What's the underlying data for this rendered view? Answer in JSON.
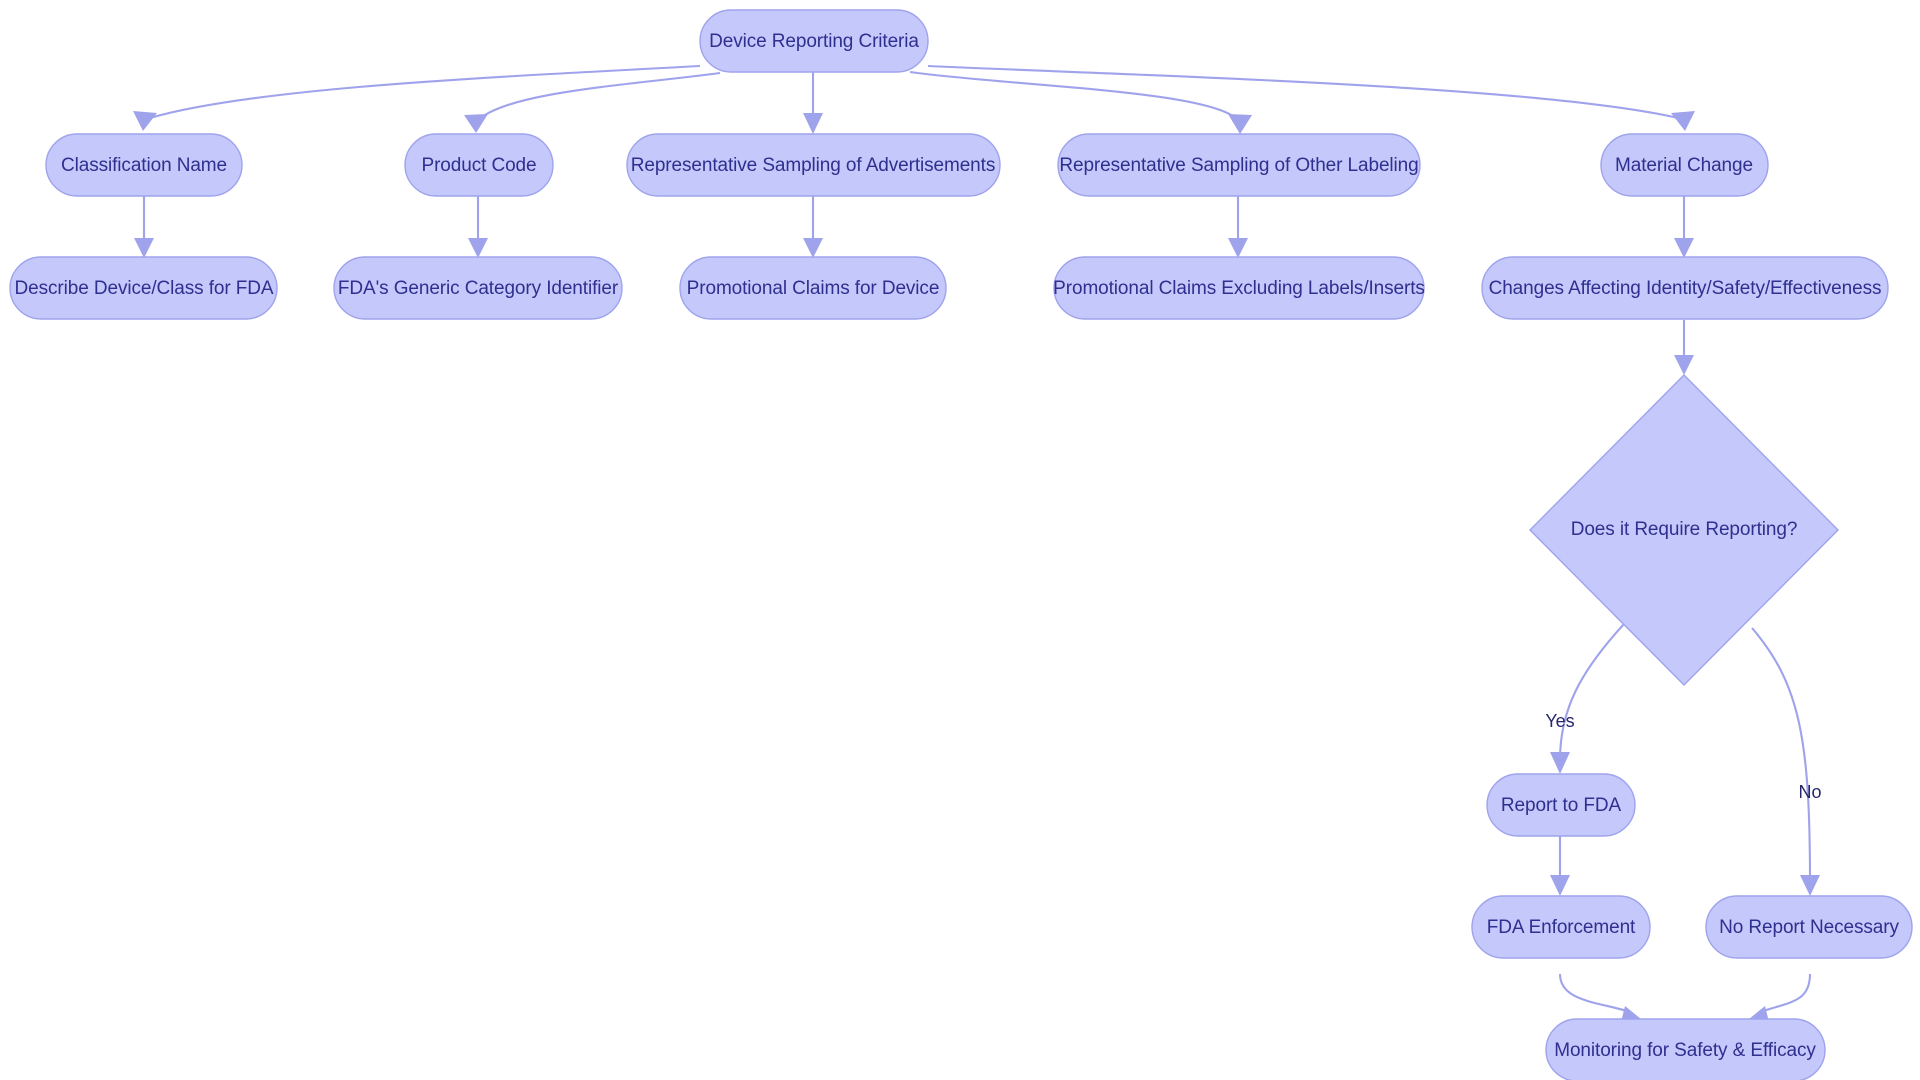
{
  "diagram": {
    "title": "Device Reporting Criteria",
    "type": "flowchart",
    "background_color": "#ffffff",
    "node_fill_color": "#c5c8fb",
    "node_border_color": "#9fa3ec",
    "node_text_color": "#2f2f8f",
    "edge_color": "#9fa3ec",
    "edge_label_color": "#27276b"
  },
  "nodes": {
    "root": {
      "label": "Device Reporting Criteria",
      "shape": "rounded-rect"
    },
    "classification_name": {
      "label": "Classification Name",
      "shape": "rounded-rect"
    },
    "product_code": {
      "label": "Product Code",
      "shape": "rounded-rect"
    },
    "rep_sampling_ads": {
      "label": "Representative Sampling of Advertisements",
      "shape": "rounded-rect"
    },
    "rep_sampling_other": {
      "label": "Representative Sampling of Other Labeling",
      "shape": "rounded-rect"
    },
    "material_change": {
      "label": "Material Change",
      "shape": "rounded-rect"
    },
    "describe_device": {
      "label": "Describe Device/Class for FDA",
      "shape": "rounded-rect"
    },
    "generic_category": {
      "label": "FDA's Generic Category Identifier",
      "shape": "rounded-rect"
    },
    "promo_claims_device": {
      "label": "Promotional Claims for Device",
      "shape": "rounded-rect"
    },
    "promo_claims_excluding": {
      "label": "Promotional Claims Excluding Labels/Inserts",
      "shape": "rounded-rect"
    },
    "changes_affecting": {
      "label": "Changes Affecting Identity/Safety/Effectiveness",
      "shape": "rounded-rect"
    },
    "decision_reporting": {
      "label": "Does it Require Reporting?",
      "shape": "diamond"
    },
    "report_to_fda": {
      "label": "Report to FDA",
      "shape": "rounded-rect"
    },
    "no_report_necessary": {
      "label": "No Report Necessary",
      "shape": "rounded-rect"
    },
    "fda_enforcement": {
      "label": "FDA Enforcement",
      "shape": "rounded-rect"
    },
    "monitoring": {
      "label": "Monitoring for Safety & Efficacy",
      "shape": "rounded-rect"
    }
  },
  "edge_labels": {
    "yes": "Yes",
    "no": "No"
  },
  "edges": [
    {
      "from": "root",
      "to": "classification_name",
      "label": ""
    },
    {
      "from": "root",
      "to": "product_code",
      "label": ""
    },
    {
      "from": "root",
      "to": "rep_sampling_ads",
      "label": ""
    },
    {
      "from": "root",
      "to": "rep_sampling_other",
      "label": ""
    },
    {
      "from": "root",
      "to": "material_change",
      "label": ""
    },
    {
      "from": "classification_name",
      "to": "describe_device",
      "label": ""
    },
    {
      "from": "product_code",
      "to": "generic_category",
      "label": ""
    },
    {
      "from": "rep_sampling_ads",
      "to": "promo_claims_device",
      "label": ""
    },
    {
      "from": "rep_sampling_other",
      "to": "promo_claims_excluding",
      "label": ""
    },
    {
      "from": "material_change",
      "to": "changes_affecting",
      "label": ""
    },
    {
      "from": "changes_affecting",
      "to": "decision_reporting",
      "label": ""
    },
    {
      "from": "decision_reporting",
      "to": "report_to_fda",
      "label": "Yes"
    },
    {
      "from": "decision_reporting",
      "to": "no_report_necessary",
      "label": "No"
    },
    {
      "from": "report_to_fda",
      "to": "fda_enforcement",
      "label": ""
    },
    {
      "from": "fda_enforcement",
      "to": "monitoring",
      "label": ""
    },
    {
      "from": "no_report_necessary",
      "to": "monitoring",
      "label": ""
    }
  ]
}
